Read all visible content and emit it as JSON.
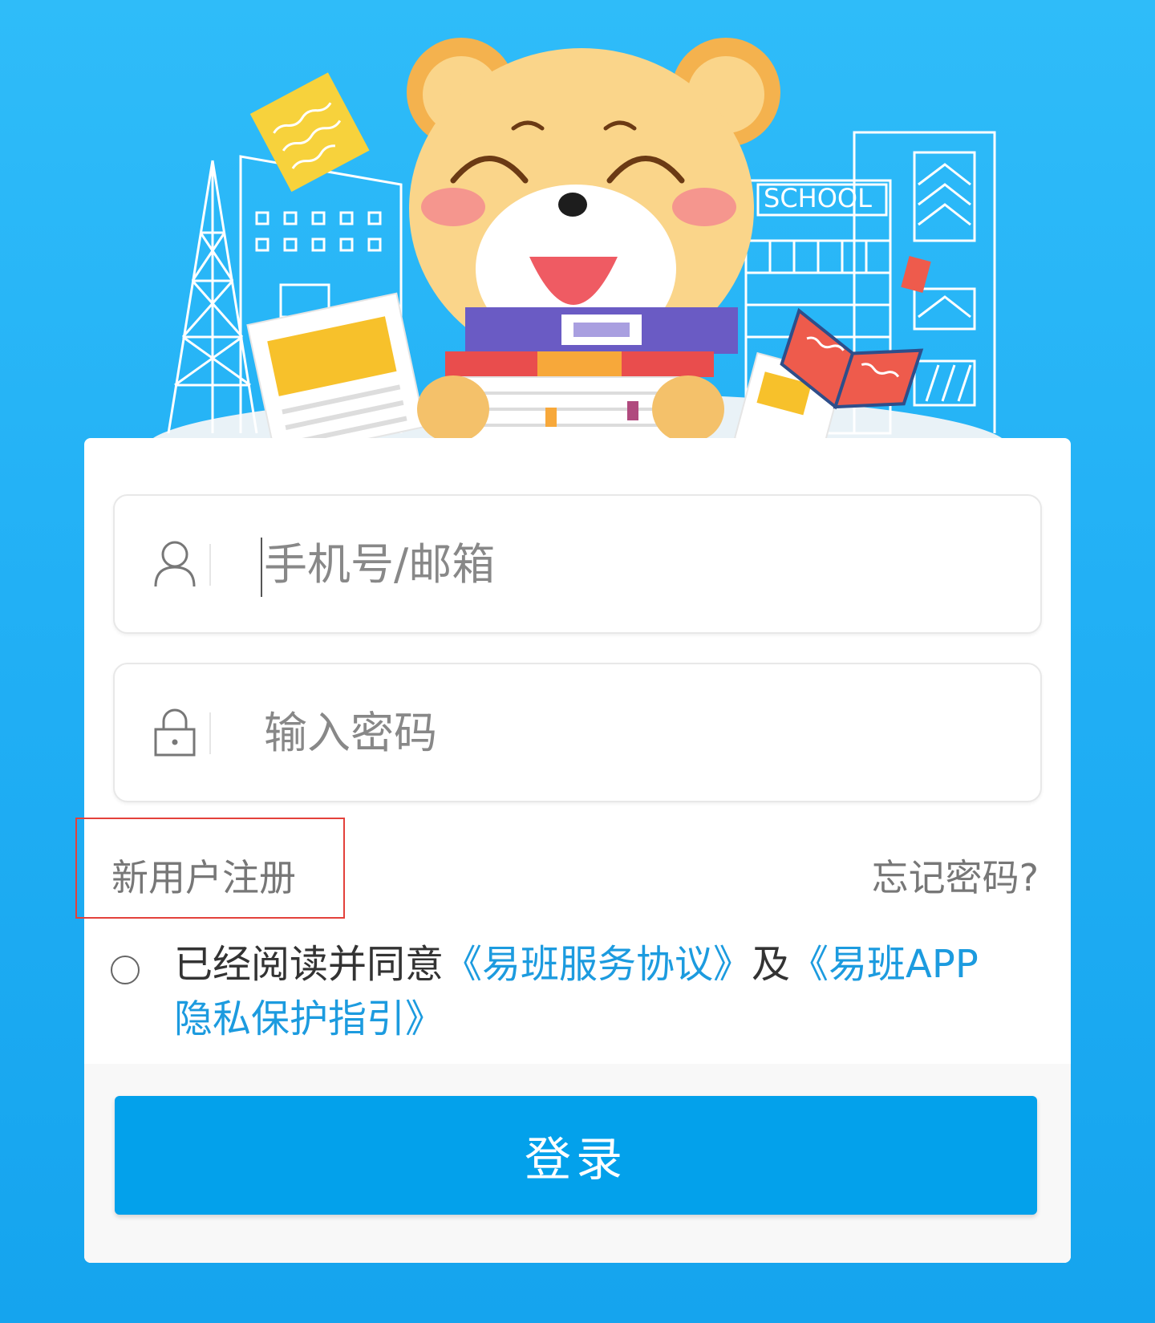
{
  "illustration": {
    "building_sign": "SCHOOL"
  },
  "login_form": {
    "username_placeholder": "手机号/邮箱",
    "password_placeholder": "输入密码",
    "register_label": "新用户注册",
    "forgot_label": "忘记密码?",
    "agreement": {
      "prefix": "已经阅读并同意",
      "service_link": "《易班服务协议》",
      "conjunction": "及",
      "privacy_link": "《易班APP隐私保护指引》"
    },
    "login_button": "登录"
  },
  "icons": {
    "username": "user-icon",
    "password": "lock-icon"
  },
  "colors": {
    "background": "#22b0f5",
    "primary": "#03a1eb",
    "link": "#1c9bdf",
    "highlight": "#e3413b"
  }
}
